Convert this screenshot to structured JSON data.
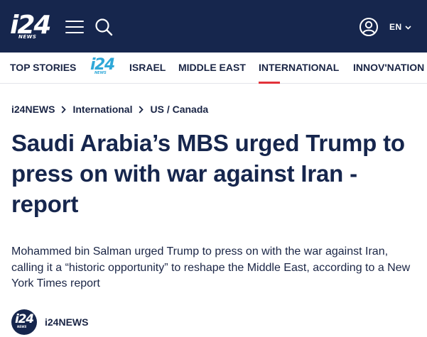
{
  "header": {
    "logo": {
      "main": "i24",
      "sub": "NEWS"
    },
    "menu_icon": "hamburger-menu-icon",
    "search_icon": "search-icon",
    "account_icon": "user-account-icon",
    "language": "EN",
    "language_icon": "chevron-down-icon",
    "background_color": "#16264d"
  },
  "nav": {
    "items": [
      {
        "label": "TOP STORIES"
      },
      {
        "label": "ISRAEL"
      },
      {
        "label": "MIDDLE EAST"
      },
      {
        "label": "INTERNATIONAL",
        "active": true
      },
      {
        "label": "INNOV'NATION"
      }
    ],
    "logo": {
      "main": "i24",
      "sub": "NEWS"
    },
    "logo_color": "#2fa8d8",
    "active_indicator_color": "#e2323a"
  },
  "breadcrumb": {
    "items": [
      "i24NEWS",
      "International",
      "US / Canada"
    ],
    "separator_icon": "chevron-right-icon"
  },
  "article": {
    "headline": "Saudi Arabia’s MBS urged Trump to press on with war against Iran - report",
    "lead": "Mohammed bin Salman urged Trump to press on with the war against Iran, calling it a “historic opportunity” to reshape the Middle East, according to a New York Times report",
    "author": {
      "name": "i24NEWS",
      "avatar": {
        "main": "i24",
        "sub": "NEWS"
      }
    }
  }
}
